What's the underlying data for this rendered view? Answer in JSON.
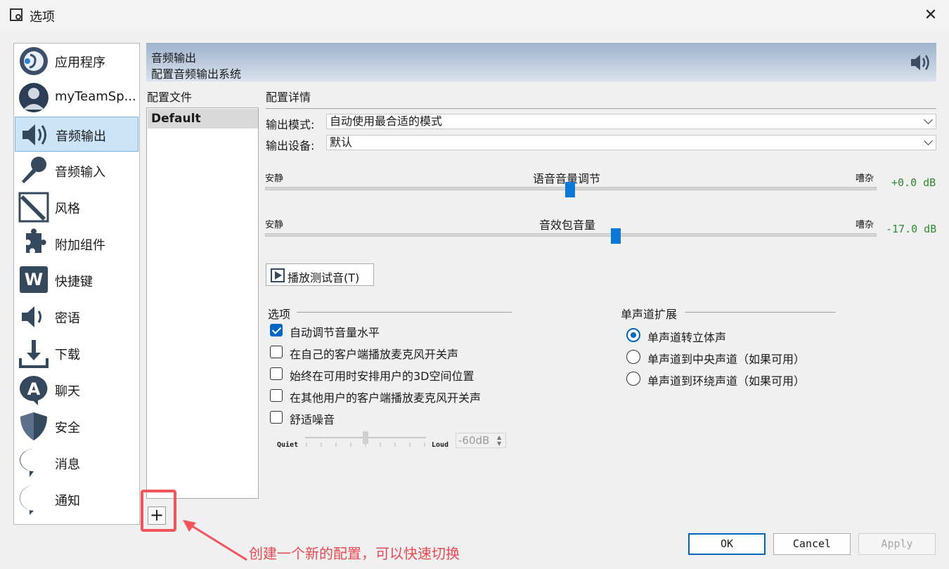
{
  "window": {
    "title": "选项",
    "close": "✕"
  },
  "sidebar": {
    "items": [
      {
        "label": "应用程序",
        "icon": "head-face-icon"
      },
      {
        "label": "myTeamSp...",
        "icon": "user-avatar-icon"
      },
      {
        "label": "音频输出",
        "icon": "speaker-icon"
      },
      {
        "label": "音频输入",
        "icon": "microphone-icon"
      },
      {
        "label": "风格",
        "icon": "paint-brush-icon"
      },
      {
        "label": "附加组件",
        "icon": "puzzle-icon"
      },
      {
        "label": "快捷键",
        "icon": "keyboard-w-icon"
      },
      {
        "label": "密语",
        "icon": "whisper-speaker-icon"
      },
      {
        "label": "下载",
        "icon": "download-icon"
      },
      {
        "label": "聊天",
        "icon": "chat-a-icon"
      },
      {
        "label": "安全",
        "icon": "shield-icon"
      },
      {
        "label": "消息",
        "icon": "abc-bubble-icon"
      },
      {
        "label": "通知",
        "icon": "info-bubble-icon"
      }
    ],
    "active_index": 2
  },
  "header": {
    "title": "音频输出",
    "subtitle": "配置音频输出系统"
  },
  "profiles": {
    "label": "配置文件",
    "items": [
      "Default"
    ],
    "add": "+"
  },
  "details": {
    "label": "配置详情",
    "output_mode": {
      "label": "输出模式:",
      "value": "自动使用最合适的模式"
    },
    "output_device": {
      "label": "输出设备:",
      "value": "默认"
    },
    "voice_volume": {
      "left": "安静",
      "title": "语音音量调节",
      "right": "嘈杂",
      "value": "+0.0 dB",
      "level": 0.5
    },
    "sound_pack_volume": {
      "left": "安静",
      "title": "音效包音量",
      "right": "嘈杂",
      "value": "-17.0 dB",
      "level": 0.575
    },
    "play_test": "播放测试音(T)"
  },
  "options": {
    "label": "选项",
    "checkboxes": [
      {
        "label": "自动调节音量水平",
        "checked": true
      },
      {
        "label": "在自己的客户端播放麦克风开关声",
        "checked": false
      },
      {
        "label": "始终在可用时安排用户的3D空间位置",
        "checked": false
      },
      {
        "label": "在其他用户的客户端播放麦克风开关声",
        "checked": false
      },
      {
        "label": "舒适噪音",
        "checked": false
      }
    ],
    "noise": {
      "quiet": "Quiet",
      "loud": "Loud",
      "value": "-60dB",
      "level": 0.5
    }
  },
  "mono": {
    "label": "单声道扩展",
    "radios": [
      {
        "label": "单声道转立体声",
        "selected": true
      },
      {
        "label": "单声道到中央声道（如果可用）",
        "selected": false
      },
      {
        "label": "单声道到环绕声道（如果可用）",
        "selected": false
      }
    ]
  },
  "buttons": {
    "ok": "OK",
    "cancel": "Cancel",
    "apply": "Apply"
  },
  "annotation": "创建一个新的配置，可以快速切换",
  "colors": {
    "accent": "#0067c0",
    "annotation": "#f2545b",
    "db_green": "#2e8b2e"
  }
}
